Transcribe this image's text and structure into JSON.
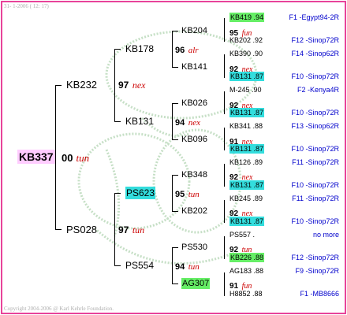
{
  "header": "31-  1-2006 ( 12: 17)",
  "footer": "Copyright 2004-2006 @ Karl Kehrle Foundation.",
  "root": {
    "name": "KB337",
    "year": "00",
    "breeder": "tun"
  },
  "gen1": [
    {
      "name": "KB232",
      "year": "97",
      "breeder": "nex"
    },
    {
      "name": "PS028",
      "year": "97",
      "breeder": "tun"
    }
  ],
  "gen2": [
    {
      "name": "KB178",
      "year": "96",
      "breeder": "alr"
    },
    {
      "name": "KB131",
      "year": "94",
      "breeder": "nex"
    },
    {
      "name": "PS623",
      "year": "95",
      "breeder": "tun"
    },
    {
      "name": "PS554",
      "year": "94",
      "breeder": "tun"
    }
  ],
  "gen3": [
    {
      "name": "KB204",
      "year": "95",
      "breeder": "fun"
    },
    {
      "name": "KB141",
      "year": "92",
      "breeder": "nex"
    },
    {
      "name": "KB026",
      "year": "92",
      "breeder": "nex"
    },
    {
      "name": "KB096",
      "year": "91",
      "breeder": "nex"
    },
    {
      "name": "KB348",
      "year": "92",
      "breeder": "nex"
    },
    {
      "name": "KB202",
      "year": "92",
      "breeder": "nex"
    },
    {
      "name": "PS530",
      "year": "92",
      "breeder": "tun"
    },
    {
      "name": "AG307",
      "year": "91",
      "breeder": "fun"
    }
  ],
  "gen4": [
    {
      "name": "KB419",
      "yr": ".94",
      "pedigree": "F1 -Egypt94-2R"
    },
    {
      "name": "KB202",
      "yr": ".92",
      "pedigree": "F12 -Sinop72R"
    },
    {
      "name": "KB390",
      "yr": ".90",
      "pedigree": "F14 -Sinop62R"
    },
    {
      "name": "KB131",
      "yr": ".87",
      "pedigree": "F10 -Sinop72R"
    },
    {
      "name": "M-245",
      "yr": ".90",
      "pedigree": "F2 -Kenya4R"
    },
    {
      "name": "KB131",
      "yr": ".87",
      "pedigree": "F10 -Sinop72R"
    },
    {
      "name": "KB341",
      "yr": ".88",
      "pedigree": "F13 -Sinop62R"
    },
    {
      "name": "KB131",
      "yr": ".87",
      "pedigree": "F10 -Sinop72R"
    },
    {
      "name": "KB126",
      "yr": ".89",
      "pedigree": "F11 -Sinop72R"
    },
    {
      "name": "KB131",
      "yr": ".87",
      "pedigree": "F10 -Sinop72R"
    },
    {
      "name": "KB245",
      "yr": ".89",
      "pedigree": "F11 -Sinop72R"
    },
    {
      "name": "KB131",
      "yr": ".87",
      "pedigree": "F10 -Sinop72R"
    },
    {
      "name": "PS557",
      "yr": ".",
      "pedigree": "no more"
    },
    {
      "name": "KB226",
      "yr": ".88",
      "pedigree": "F12 -Sinop72R"
    },
    {
      "name": "AG183",
      "yr": ".88",
      "pedigree": "F9 -Sinop72R"
    },
    {
      "name": "H8852",
      "yr": ".88",
      "pedigree": "F1 -MB8666"
    }
  ],
  "colors": {
    "border": "#e8449a",
    "root_bg": "#ffccff",
    "green": "#66ee66",
    "cyan": "#33dddd",
    "pedigree": "#0000cc",
    "breeder": "#cc0000"
  }
}
